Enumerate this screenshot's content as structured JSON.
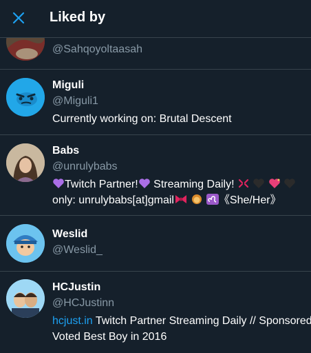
{
  "header": {
    "title": "Liked by",
    "accent": "#1da1f2"
  },
  "users": [
    {
      "handle": "@Sahqoyoltaasah"
    },
    {
      "name": "Miguli",
      "handle": "@Miguli1",
      "bio": "Currently working on: Brutal Descent"
    },
    {
      "name": "Babs",
      "handle": "@unrulybabs",
      "bio_line1_a": "Twitch Partner!",
      "bio_line1_b": " Streaming Daily! ",
      "bio_line2_a": "only: unrulybabs[at]gmail",
      "bio_line2_b": "《She/Her》"
    },
    {
      "name": "Weslid",
      "handle": "@Weslid_"
    },
    {
      "name": "HCJustin",
      "handle": "@HCJustinn",
      "bio_link": "hcjust.in",
      "bio_line1": " Twitch Partner Streaming Daily // Sponsored",
      "bio_line2": "Voted Best Boy in 2016"
    }
  ]
}
